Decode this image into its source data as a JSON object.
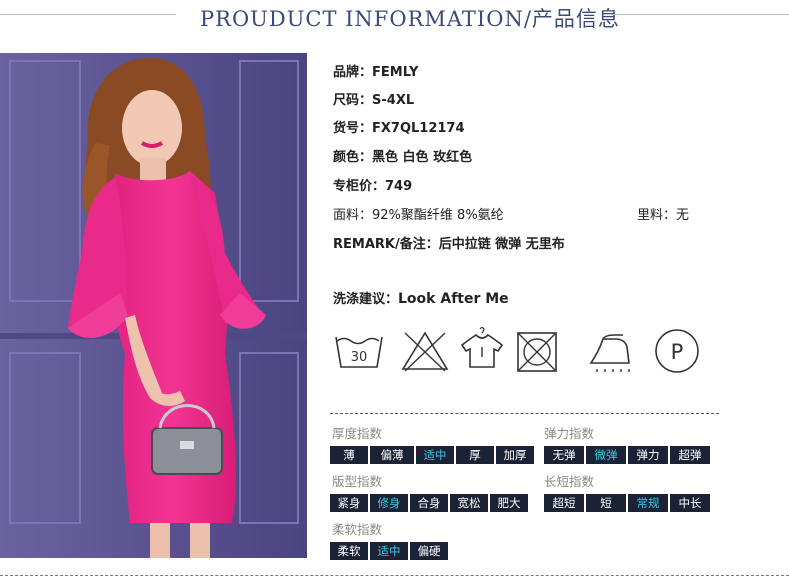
{
  "header": {
    "title": "PROUDUCT INFORMATION/产品信息"
  },
  "product": {
    "brand_label": "品牌：",
    "brand": "FEMLY",
    "size_label": "尺码：",
    "size": "S-4XL",
    "sku_label": "货号：",
    "sku": "FX7QL12174",
    "color_label": "颜色：",
    "color": "黑色 白色 玫红色",
    "price_label": "专柜价：",
    "price": "749",
    "fabric_label": "面料：",
    "fabric": "92%聚酯纤维 8%氨纶",
    "lining_label": "里料：",
    "lining": "无",
    "remark_label": "REMARK/备注：",
    "remark": "后中拉链 微弹 无里布"
  },
  "care": {
    "label": "洗涤建议：",
    "value": "Look After Me",
    "wash_temp": "30",
    "dryclean_letter": "P",
    "icons": [
      "wash-30-icon",
      "no-bleach-icon",
      "hang-dry-icon",
      "no-tumble-dry-icon",
      "iron-steam-icon",
      "dry-clean-p-icon"
    ]
  },
  "indices": {
    "thickness": {
      "title": "厚度指数",
      "options": [
        "薄",
        "偏薄",
        "适中",
        "厚",
        "加厚"
      ],
      "selected": "适中"
    },
    "elasticity": {
      "title": "弹力指数",
      "options": [
        "无弹",
        "微弹",
        "弹力",
        "超弹"
      ],
      "selected": "微弹"
    },
    "fit": {
      "title": "版型指数",
      "options": [
        "紧身",
        "修身",
        "合身",
        "宽松",
        "肥大"
      ],
      "selected": "修身"
    },
    "length": {
      "title": "长短指数",
      "options": [
        "超短",
        "短",
        "常规",
        "中长"
      ],
      "selected": "常规"
    },
    "softness": {
      "title": "柔软指数",
      "options": [
        "柔软",
        "适中",
        "偏硬"
      ],
      "selected": "适中"
    }
  },
  "colors": {
    "title": "#3c4a78",
    "chip_bg": "#1c2236",
    "chip_selected_text": "#39c8e4",
    "dress": "#ee2d8f",
    "wall": "#5b5490"
  }
}
